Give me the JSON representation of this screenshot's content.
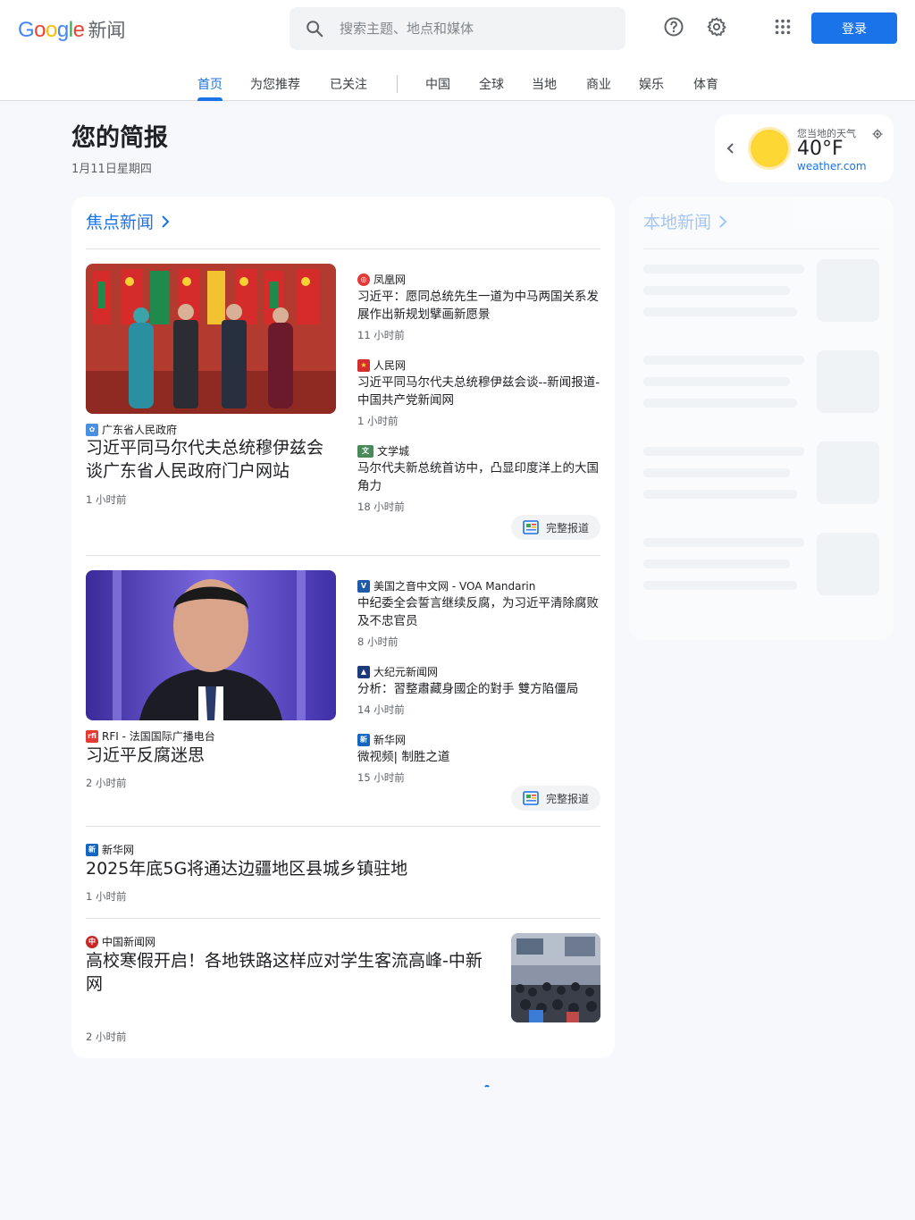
{
  "header": {
    "logo_word": "Google",
    "logo_suffix": "新闻",
    "search_placeholder": "搜索主题、地点和媒体",
    "login_label": "登录"
  },
  "nav": {
    "items": [
      {
        "label": "首页",
        "active": true
      },
      {
        "label": "为您推荐"
      },
      {
        "label": "已关注"
      },
      {
        "label": "中国"
      },
      {
        "label": "全球"
      },
      {
        "label": "当地"
      },
      {
        "label": "商业"
      },
      {
        "label": "娱乐"
      },
      {
        "label": "体育"
      }
    ]
  },
  "briefing": {
    "title": "您的简报",
    "date": "1月11日星期四"
  },
  "weather": {
    "label": "您当地的天气",
    "temp": "40°F",
    "source": "weather.com"
  },
  "top_stories": {
    "title": "焦点新闻",
    "full_coverage_label": "完整报道",
    "cluster1": {
      "main": {
        "source": "广东省人民政府",
        "headline": "习近平同马尔代夫总统穆伊兹会谈广东省人民政府门户网站",
        "time": "1 小时前"
      },
      "related": [
        {
          "source": "凤凰网",
          "headline": "习近平：愿同总统先生一道为中马两国关系发展作出新规划擘画新愿景",
          "time": "11 小时前"
        },
        {
          "source": "人民网",
          "headline": "习近平同马尔代夫总统穆伊兹会谈--新闻报道-中国共产党新闻网",
          "time": "1 小时前"
        },
        {
          "source": "文学城",
          "headline": "马尔代夫新总统首访中，凸显印度洋上的大国角力",
          "time": "18 小时前"
        }
      ]
    },
    "cluster2": {
      "main": {
        "source": "RFI - 法国国际广播电台",
        "headline": "习近平反腐迷思",
        "time": "2 小时前"
      },
      "related": [
        {
          "source": "美国之音中文网 - VOA Mandarin",
          "headline": "中纪委全会誓言继续反腐，为习近平清除腐败及不忠官员",
          "time": "8 小时前"
        },
        {
          "source": "大纪元新闻网",
          "headline": "分析：習整肅藏身國企的對手 雙方陷僵局",
          "time": "14 小时前"
        },
        {
          "source": "新华网",
          "headline": "微视频| 制胜之道",
          "time": "15 小时前"
        }
      ]
    },
    "story3": {
      "source": "新华网",
      "headline": "2025年底5G将通达边疆地区县城乡镇驻地",
      "time": "1 小时前"
    },
    "story4": {
      "source": "中国新闻网",
      "headline": "高校寒假开启！各地铁路这样应对学生客流高峰-中新网",
      "time": "2 小时前"
    }
  },
  "local": {
    "title": "本地新闻"
  },
  "colors": {
    "accent": "#1a73e8",
    "background": "#f6f8fc"
  }
}
